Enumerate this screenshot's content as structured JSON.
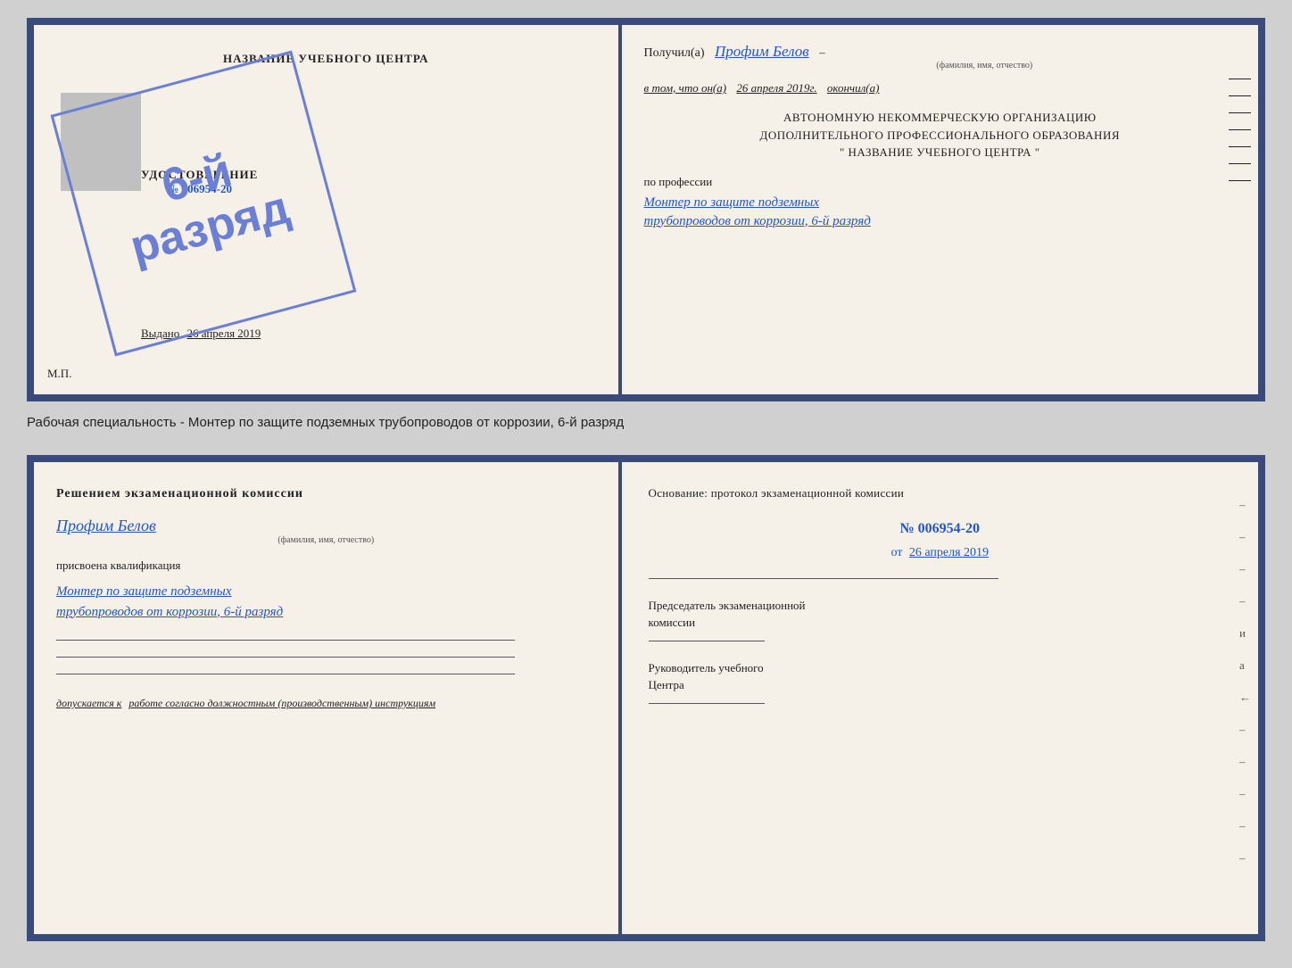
{
  "page": {
    "background_color": "#d0d0d0"
  },
  "top_cert": {
    "left": {
      "title": "НАЗВАНИЕ УЧЕБНОГО ЦЕНТРА",
      "gray_box_label": "фото",
      "udostoverenie_title": "УДОСТОВЕРЕНИЕ",
      "number_prefix": "№",
      "number": "006954-20",
      "vydano_label": "Выдано",
      "vydano_date": "26 апреля 2019",
      "mp_label": "М.П."
    },
    "stamp": {
      "line1": "6-й",
      "line2": "разряд"
    },
    "right": {
      "poluchil_label": "Получил(а)",
      "poluchil_name": "Профим Белов",
      "familiya_label": "(фамилия, имя, отчество)",
      "vtom_label": "в том, что он(а)",
      "vtom_date": "26 апреля 2019г.",
      "okonchil_label": "окончил(а)",
      "org_line1": "АВТОНОМНУЮ НЕКОММЕРЧЕСКУЮ ОРГАНИЗАЦИЮ",
      "org_line2": "ДОПОЛНИТЕЛЬНОГО ПРОФЕССИОНАЛЬНОГО ОБРАЗОВАНИЯ",
      "org_name": "\"  НАЗВАНИЕ УЧЕБНОГО ЦЕНТРА  \"",
      "po_professii_label": "по профессии",
      "professiya_line1": "Монтер по защите подземных",
      "professiya_line2": "трубопроводов от коррозии, 6-й разряд",
      "dashes": [
        "–",
        "–",
        "–",
        "–",
        "–",
        "–",
        "–",
        "–"
      ]
    }
  },
  "description": {
    "text": "Рабочая специальность - Монтер по защите подземных трубопроводов от коррозии, 6-й разряд"
  },
  "bottom_cert": {
    "left": {
      "reshenie_title": "Решением экзаменационной комиссии",
      "person_name": "Профим Белов",
      "familiya_label": "(фамилия, имя, отчество)",
      "prisvoena_label": "присвоена квалификация",
      "kvalifikaciya_line1": "Монтер по защите подземных",
      "kvalifikaciya_line2": "трубопроводов от коррозии, 6-й разряд",
      "dopuskaetsya_prefix": "допускается к",
      "dopuskaetsya_text": "работе согласно должностным (производственным) инструкциям"
    },
    "right": {
      "osnovanie_label": "Основание: протокол экзаменационной комиссии",
      "number_prefix": "№",
      "number": "006954-20",
      "ot_prefix": "от",
      "ot_date": "26 апреля 2019",
      "predsedatel_line1": "Председатель экзаменационной",
      "predsedatel_line2": "комиссии",
      "rukovoditel_line1": "Руководитель учебного",
      "rukovoditel_line2": "Центра",
      "dashes": [
        "–",
        "–",
        "–",
        "–",
        "и",
        "а",
        "←",
        "–",
        "–",
        "–",
        "–",
        "–"
      ]
    }
  }
}
